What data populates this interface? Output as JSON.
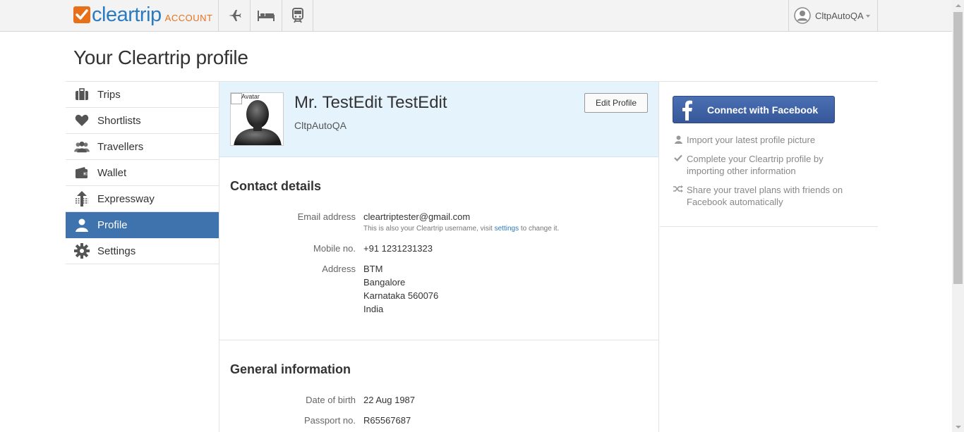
{
  "header": {
    "logo_text": "cleartrip",
    "logo_sub": "ACCOUNT",
    "nav_icons": [
      "flight-icon",
      "hotel-icon",
      "train-icon"
    ],
    "user_name": "CltpAutoQA"
  },
  "page": {
    "title": "Your Cleartrip profile"
  },
  "sidebar": {
    "items": [
      {
        "label": "Trips",
        "icon": "briefcase-icon"
      },
      {
        "label": "Shortlists",
        "icon": "heart-icon"
      },
      {
        "label": "Travellers",
        "icon": "people-icon"
      },
      {
        "label": "Wallet",
        "icon": "wallet-icon"
      },
      {
        "label": "Expressway",
        "icon": "expressway-icon"
      },
      {
        "label": "Profile",
        "icon": "user-icon",
        "active": true
      },
      {
        "label": "Settings",
        "icon": "gear-icon"
      }
    ]
  },
  "profile": {
    "avatar_alt": "Avatar",
    "name": "Mr. TestEdit TestEdit",
    "username": "CltpAutoQA",
    "edit_label": "Edit Profile"
  },
  "contact": {
    "title": "Contact details",
    "email_label": "Email address",
    "email_value": "cleartriptester@gmail.com",
    "email_note_pre": "This is also your Cleartrip username, visit ",
    "email_note_link": "settings",
    "email_note_post": " to change it.",
    "mobile_label": "Mobile no.",
    "mobile_value": "+91 1231231323",
    "address_label": "Address",
    "address_lines": [
      "BTM",
      "Bangalore",
      "Karnataka 560076",
      "India"
    ]
  },
  "general": {
    "title": "General information",
    "dob_label": "Date of birth",
    "dob_value": "22 Aug 1987",
    "passport_label": "Passport no.",
    "passport_value": "R65567687"
  },
  "facebook": {
    "button_label": "Connect with Facebook",
    "perks": [
      "Import your latest profile picture",
      "Complete your Cleartrip profile by importing other information",
      "Share your travel plans with friends on Facebook automatically"
    ]
  },
  "colors": {
    "brand_orange": "#e7711b",
    "brand_blue": "#2b7bc0",
    "active_nav": "#3f73ad",
    "facebook": "#3b5998"
  }
}
